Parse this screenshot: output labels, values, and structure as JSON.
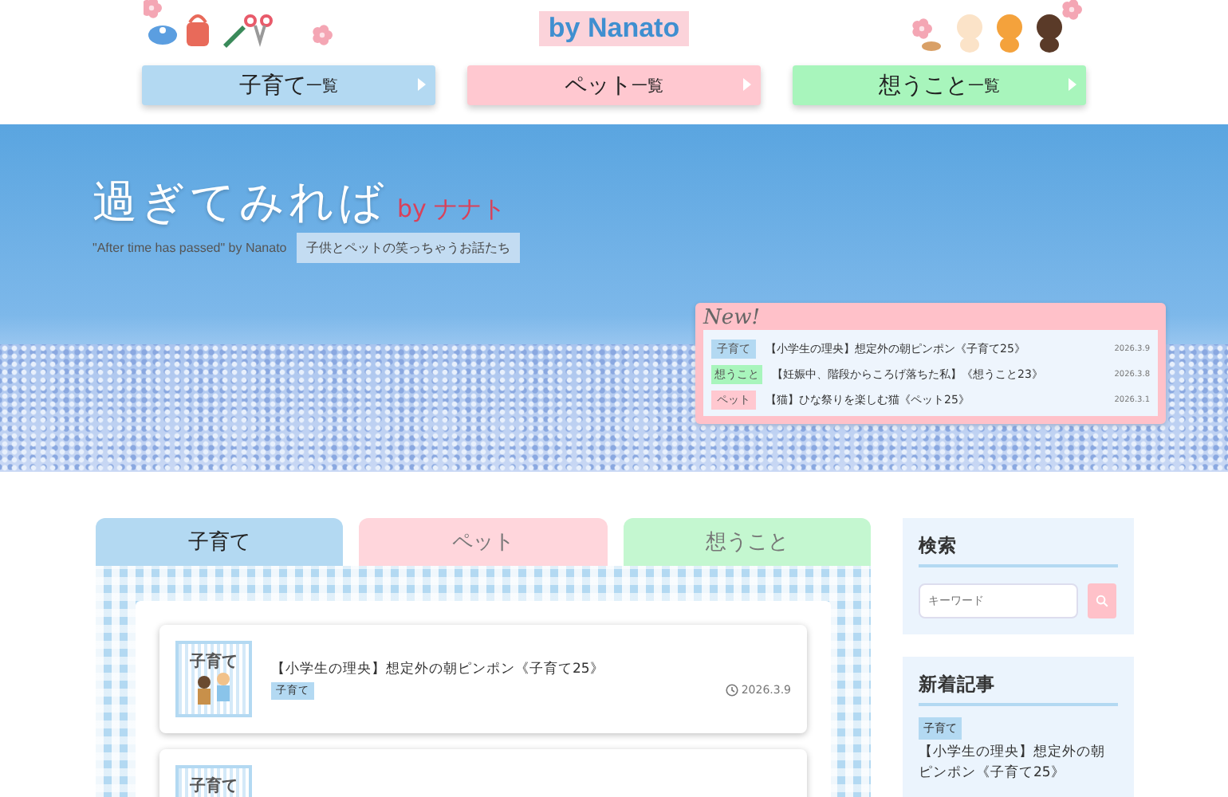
{
  "header": {
    "logo": "by Nanato",
    "nav": [
      {
        "label": "子育て",
        "suffix": "一覧",
        "color": "#b3d9f2"
      },
      {
        "label": "ペット",
        "suffix": "一覧",
        "color": "#ffc8d0"
      },
      {
        "label": "想うこと",
        "suffix": "一覧",
        "color": "#a8f5bc"
      }
    ]
  },
  "hero": {
    "title": "過ぎてみれば",
    "byline": "by ナナト",
    "tagline": "\"After time has passed\" by Nanato",
    "catch": "子供とペットの笑っちゃうお話たち",
    "news": {
      "heading": "New!",
      "items": [
        {
          "tag": "子育て",
          "color": "#b3d9f2",
          "title": "【小学生の理央】想定外の朝ピンポン《子育て25》",
          "date": "2026.3.9"
        },
        {
          "tag": "想うこと",
          "color": "#a8f5bc",
          "title": "【妊娠中、階段からころげ落ちた私】《想うこと23》",
          "date": "2026.3.8"
        },
        {
          "tag": "ペット",
          "color": "#ffc8d0",
          "title": "【猫】ひな祭りを楽しむ猫《ペット25》",
          "date": "2026.3.1"
        }
      ]
    }
  },
  "tabs": [
    {
      "label": "子育て",
      "selected": true,
      "color": "#b3d9f2"
    },
    {
      "label": "ペット",
      "selected": false,
      "color": "#ffd6dc"
    },
    {
      "label": "想うこと",
      "selected": false,
      "color": "#c4f7d0"
    }
  ],
  "posts": [
    {
      "thumb_label": "子育て",
      "title": "【小学生の理央】想定外の朝ピンポン《子育て25》",
      "tag": "子育て",
      "date": "2026.3.9"
    },
    {
      "thumb_label": "子育て"
    }
  ],
  "sidebar": {
    "search": {
      "heading": "検索",
      "placeholder": "キーワード"
    },
    "recent": {
      "heading": "新着記事",
      "items": [
        {
          "tag": "子育て",
          "title": "【小学生の理央】想定外の朝ピンポン《子育て25》"
        }
      ]
    }
  }
}
